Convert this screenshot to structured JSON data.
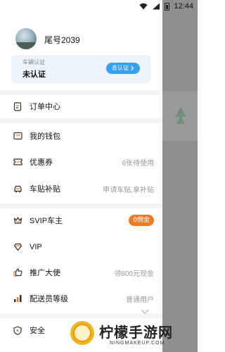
{
  "status_bar": {
    "time": "12:44"
  },
  "profile": {
    "username": "尾号2039",
    "vehicle_label": "车辆认证",
    "vehicle_status": "未认证",
    "verify_button": "去认证"
  },
  "menu": [
    {
      "id": "orders",
      "label": "订单中心",
      "extra": "",
      "icon": "order-icon"
    },
    {
      "id": "wallet",
      "label": "我的钱包",
      "extra": "",
      "icon": "wallet-icon"
    },
    {
      "id": "coupons",
      "label": "优惠券",
      "extra": "6张待使用",
      "icon": "coupon-icon"
    },
    {
      "id": "car-subsidy",
      "label": "车贴补贴",
      "extra": "申请车贴,拿补贴",
      "icon": "car-icon"
    },
    {
      "id": "svip",
      "label": "SVIP车主",
      "badge": "0佣金",
      "icon": "crown-icon"
    },
    {
      "id": "vip",
      "label": "VIP",
      "extra": "",
      "icon": "diamond-icon"
    },
    {
      "id": "promoter",
      "label": "推广大使",
      "extra": "领800元现金",
      "icon": "thumbs-up-icon"
    },
    {
      "id": "courier-level",
      "label": "配送员等级",
      "extra": "普通用户",
      "icon": "level-icon"
    },
    {
      "id": "security",
      "label": "安全",
      "extra": "",
      "icon": "shield-icon"
    }
  ],
  "watermark": {
    "title": "柠檬手游网",
    "subtitle": "NINGMAKEUP.COM"
  },
  "colors": {
    "accent_blue": "#3aa0ee",
    "badge_orange": "#f07a24",
    "card_bg": "#eef4fb"
  }
}
